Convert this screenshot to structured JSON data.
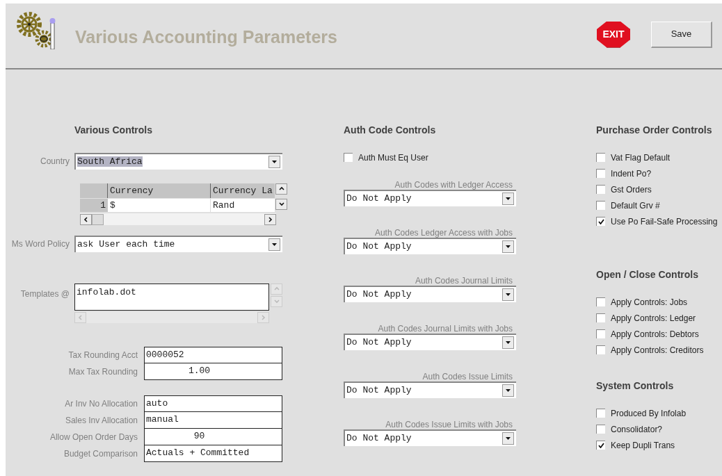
{
  "title": "Various Accounting Parameters",
  "exit_label": "EXIT",
  "save_label": "Save",
  "various_controls": {
    "heading": "Various Controls",
    "country": {
      "label": "Country",
      "value": "South Africa",
      "highlighted": true
    },
    "currency_grid": {
      "columns": [
        "Currency",
        "Currency La"
      ],
      "rows": [
        {
          "row_number": "1",
          "cells": [
            "$",
            "Rand"
          ]
        }
      ]
    },
    "ms_word_policy": {
      "label": "Ms Word Policy",
      "value": "ask User each time"
    },
    "templates": {
      "label": "Templates @",
      "value": "infolab.dot"
    },
    "tax_fields": [
      {
        "label": "Tax Rounding Acct",
        "value": "0000052",
        "kind": "text"
      },
      {
        "label": "Max Tax Rounding",
        "value": "1.00",
        "kind": "number"
      }
    ],
    "allocation_fields": [
      {
        "label": "Ar Inv No Allocation",
        "value": "auto",
        "kind": "text"
      },
      {
        "label": "Sales Inv Allocation",
        "value": "manual",
        "kind": "text"
      },
      {
        "label": "Allow Open Order Days",
        "value": "90",
        "kind": "number"
      },
      {
        "label": "Budget Comparison",
        "value": "Actuals + Committed",
        "kind": "text"
      }
    ]
  },
  "auth_code_controls": {
    "heading": "Auth Code Controls",
    "checkbox": {
      "label": "Auth Must Eq User",
      "checked": false
    },
    "selects": [
      {
        "label": "Auth Codes with Ledger Access",
        "value": "Do Not Apply"
      },
      {
        "label": "Auth Codes Ledger Access with Jobs",
        "value": "Do Not Apply"
      },
      {
        "label": "Auth Codes Journal Limits",
        "value": "Do Not Apply"
      },
      {
        "label": "Auth Codes Journal Limits with Jobs",
        "value": "Do Not Apply"
      },
      {
        "label": "Auth Codes Issue Limits",
        "value": "Do Not Apply"
      },
      {
        "label": "Auth Codes Issue Limits with Jobs",
        "value": "Do Not Apply"
      }
    ]
  },
  "purchase_order_controls": {
    "heading": "Purchase Order Controls",
    "checkboxes": [
      {
        "label": "Vat Flag Default",
        "checked": false
      },
      {
        "label": "Indent Po?",
        "checked": false
      },
      {
        "label": "Gst Orders",
        "checked": false
      },
      {
        "label": "Default Grv #",
        "checked": false
      },
      {
        "label": "Use Po Fail-Safe Processing",
        "checked": true
      }
    ]
  },
  "open_close_controls": {
    "heading": "Open / Close Controls",
    "checkboxes": [
      {
        "label": "Apply Controls: Jobs",
        "checked": false
      },
      {
        "label": "Apply Controls: Ledger",
        "checked": false
      },
      {
        "label": "Apply Controls: Debtors",
        "checked": false
      },
      {
        "label": "Apply Controls: Creditors",
        "checked": false
      }
    ]
  },
  "system_controls": {
    "heading": "System Controls",
    "checkboxes": [
      {
        "label": "Produced By Infolab",
        "checked": false
      },
      {
        "label": "Consolidator?",
        "checked": false
      },
      {
        "label": "Keep Dupli Trans",
        "checked": true
      }
    ]
  }
}
